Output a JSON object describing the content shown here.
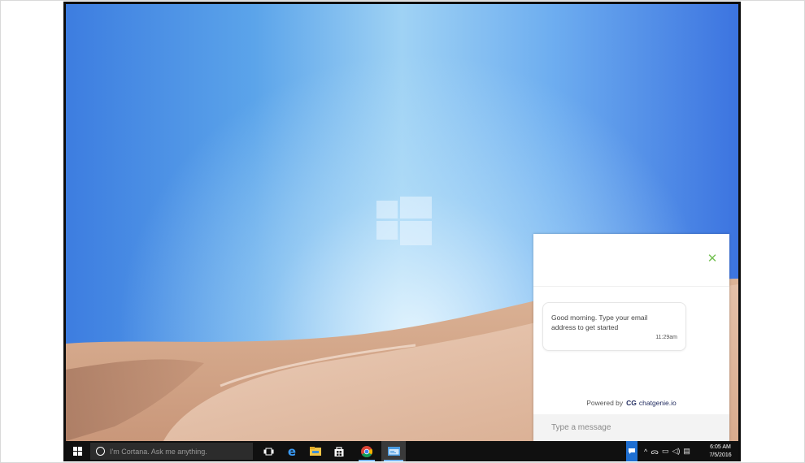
{
  "desktop": {
    "wallpaper": "windows-desert-dunes",
    "colors": {
      "sky_left": "#3d7de0",
      "sky_center": "#9fd2f4",
      "sand": "#d5a98a"
    }
  },
  "taskbar": {
    "search_placeholder": "I'm Cortana. Ask me anything.",
    "apps": [
      {
        "icon": "task-view-icon",
        "running": false
      },
      {
        "icon": "edge-icon",
        "running": false
      },
      {
        "icon": "file-explorer-icon",
        "running": false
      },
      {
        "icon": "store-icon",
        "running": false
      },
      {
        "icon": "chrome-icon",
        "running": true
      },
      {
        "icon": "app-window-icon",
        "running": true,
        "active": true
      }
    ],
    "tray_icons": [
      "chevron-up-icon",
      "people-icon",
      "network-icon",
      "volume-icon",
      "keyboard-icon"
    ],
    "clock_time": "6:05 AM",
    "clock_date": "7/5/2016",
    "accent_color": "#1f6fd1"
  },
  "chat_widget": {
    "close_icon": "close-icon",
    "message_text": "Good morning. Type your email address to get started",
    "message_time": "11:29am",
    "powered_by": "Powered by",
    "brand_logo": "CG",
    "brand_name": "chatgenie.io",
    "input_placeholder": "Type a message",
    "accent_color": "#78c257"
  }
}
